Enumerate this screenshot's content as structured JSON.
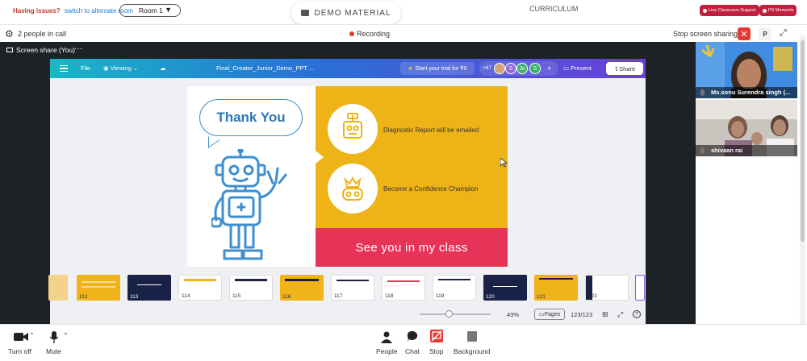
{
  "topbar": {
    "issues_label": "Having issues?",
    "alternate_link": "switch to alternate room",
    "room_selected": "Room 1",
    "demo_material": "DEMO MATERIAL",
    "curriculum": "CURRICULUM",
    "live_support": "Live Classroom Support",
    "ps_moments": "PS Moments"
  },
  "callbar": {
    "people_in_call": "2 people in call",
    "recording": "Recording",
    "stop_sharing": "Stop screen sharing",
    "p_label": "P"
  },
  "share_tab": {
    "label": "Screen share (You)",
    "menu": "···"
  },
  "canva": {
    "file": "File",
    "viewing": "Viewing",
    "filename": "Final_Creator_Junior_Demo_PPT ...",
    "trial": "Start your trial for ₹0",
    "collab_count": "+67",
    "avatars": [
      "S",
      "Jo",
      "S"
    ],
    "add": "+",
    "present": "Present",
    "share": "Share",
    "zoom": "43%",
    "pages_label": "Pages",
    "page_count": "123/123",
    "help": "?"
  },
  "slide": {
    "thank_you": "Thank You",
    "bullet1": "Diagnostic Report will be emailed",
    "bullet2": "Become a Confidence Champion",
    "footer": "See you in my class"
  },
  "thumbnails": [
    {
      "num": ""
    },
    {
      "num": "112"
    },
    {
      "num": "113"
    },
    {
      "num": "114"
    },
    {
      "num": "115"
    },
    {
      "num": "116"
    },
    {
      "num": "117"
    },
    {
      "num": "118"
    },
    {
      "num": "119"
    },
    {
      "num": "120"
    },
    {
      "num": "121"
    },
    {
      "num": "122"
    },
    {
      "num": ""
    }
  ],
  "participants": [
    {
      "name": "Ms.sonu Surendra singh (..."
    },
    {
      "name": "shivaan rai"
    }
  ],
  "bottombar": {
    "camera": "Turn off",
    "mic": "Mute",
    "people": "People",
    "chat": "Chat",
    "stop": "Stop",
    "background": "Background"
  },
  "colors": {
    "accent_red": "#e53935",
    "slide_yellow": "#eeb417",
    "slide_pink": "#e63358",
    "robot_blue": "#3d8fd0"
  }
}
